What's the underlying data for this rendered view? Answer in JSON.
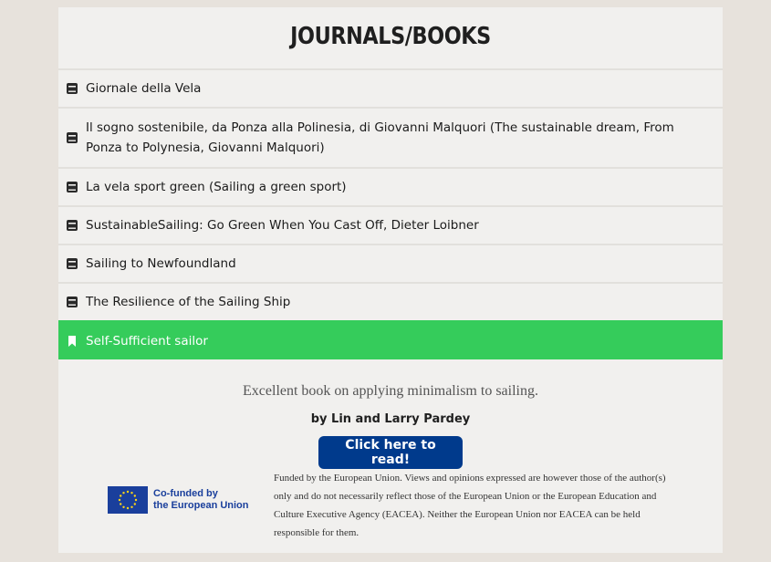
{
  "title": "JOURNALS/BOOKS",
  "items": [
    {
      "label": "Giornale della Vela"
    },
    {
      "label": "Il sogno sostenibile, da Ponza alla Polinesia, di Giovanni Malquori (The sustainable dream, From Ponza to Polynesia, Giovanni Malquori)"
    },
    {
      "label": "La vela sport green (Sailing a green sport)"
    },
    {
      "label": "SustainableSailing: Go Green When You Cast Off, Dieter Loibner"
    },
    {
      "label": "Sailing to Newfoundland"
    },
    {
      "label": "The Resilience of the Sailing Ship"
    },
    {
      "label": "Self-Sufficient sailor"
    }
  ],
  "selected": {
    "description": "Excellent book on applying minimalism to sailing.",
    "author": "by Lin and Larry Pardey",
    "button_label": "Click here to read!"
  },
  "footer": {
    "eu_logo_line1": "Co-funded by",
    "eu_logo_line2": "the European Union",
    "disclaimer": "Funded by the European Union. Views and opinions expressed are however those of the author(s) only and do not necessarily reflect those of the European Union or the European Education and Culture Executive Agency (EACEA). Neither the European Union nor EACEA can be held responsible for them."
  },
  "colors": {
    "active_item": "#35cc5b",
    "button": "#003a8c",
    "eu_blue": "#1a3f9c",
    "eu_star": "#ffd617"
  },
  "icons": {
    "book": "book-icon",
    "bookmark": "bookmark-icon"
  }
}
